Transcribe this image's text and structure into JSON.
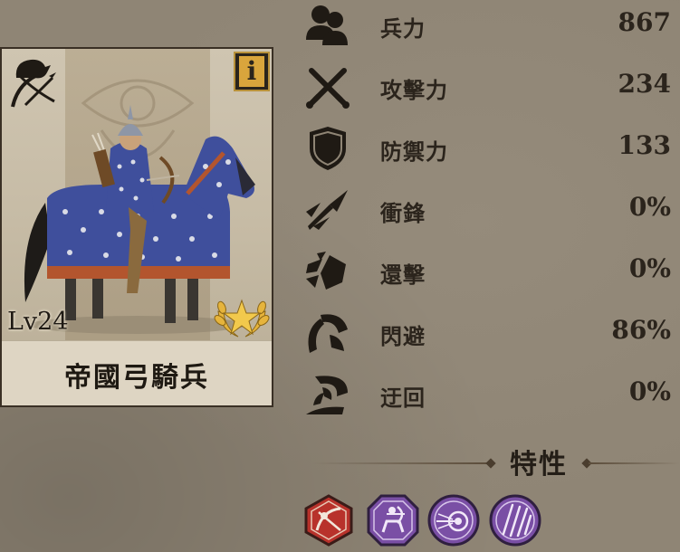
{
  "unit": {
    "name": "帝國弓騎兵",
    "level": "Lv24",
    "class_icon": "horse-archer-icon",
    "rank_icon": "gold-star-laurel-icon",
    "info_glyph": "i"
  },
  "stats": [
    {
      "label": "兵力",
      "value": "867",
      "icon": "troops-icon"
    },
    {
      "label": "攻擊力",
      "value": "234",
      "icon": "crossed-swords-icon"
    },
    {
      "label": "防禦力",
      "value": "133",
      "icon": "shield-icon"
    },
    {
      "label": "衝鋒",
      "value": "0%",
      "icon": "charge-spear-icon"
    },
    {
      "label": "還擊",
      "value": "0%",
      "icon": "counter-strike-icon"
    },
    {
      "label": "閃避",
      "value": "86%",
      "icon": "evasion-icon"
    },
    {
      "label": "迂回",
      "value": "0%",
      "icon": "flank-icon"
    }
  ],
  "traits": {
    "title": "特性",
    "badges": [
      {
        "icon": "mounted-archer-trait-icon",
        "color": "#b8322b"
      },
      {
        "icon": "centaur-archer-trait-icon",
        "color": "#7a4fa5"
      },
      {
        "icon": "target-arrow-trait-icon",
        "color": "#7a4fa5"
      },
      {
        "icon": "arrow-volley-trait-icon",
        "color": "#7a4fa5"
      }
    ]
  },
  "colors": {
    "background": "#8f8575",
    "text": "#2b241c",
    "icon": "#1f1a14",
    "gold": "#d9a53c",
    "armor_blue": "#3f4f9c"
  }
}
